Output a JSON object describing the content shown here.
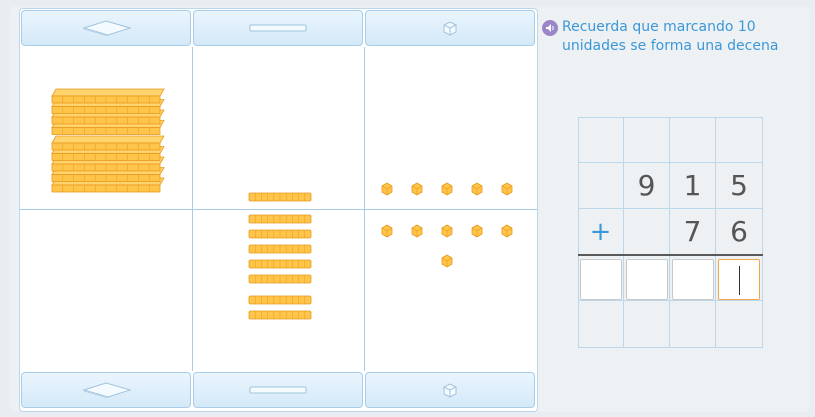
{
  "hint": {
    "text": "Recuerda que marcando 10 unidades se forma una decena",
    "icon": "speaker-icon"
  },
  "columns": [
    {
      "id": "centenas",
      "icon": "hundred-flat-icon"
    },
    {
      "id": "decenas",
      "icon": "ten-rod-icon"
    },
    {
      "id": "unidades",
      "icon": "unit-cube-icon"
    }
  ],
  "blocks": {
    "top_row": {
      "hundreds": 9,
      "tens": 1,
      "units": 5
    },
    "bottom_row": {
      "hundreds": 0,
      "tens": 7,
      "units": 6
    }
  },
  "operation": {
    "operator": "+",
    "row1": [
      "",
      "9",
      "1",
      "5"
    ],
    "row2": [
      "",
      "",
      "7",
      "6"
    ],
    "answer": [
      "",
      "",
      "",
      ""
    ],
    "active_answer_index": 3
  },
  "colors": {
    "block_fill": "#ffc44a",
    "block_stroke": "#e89a1c",
    "accent_blue": "#3a98d8"
  }
}
